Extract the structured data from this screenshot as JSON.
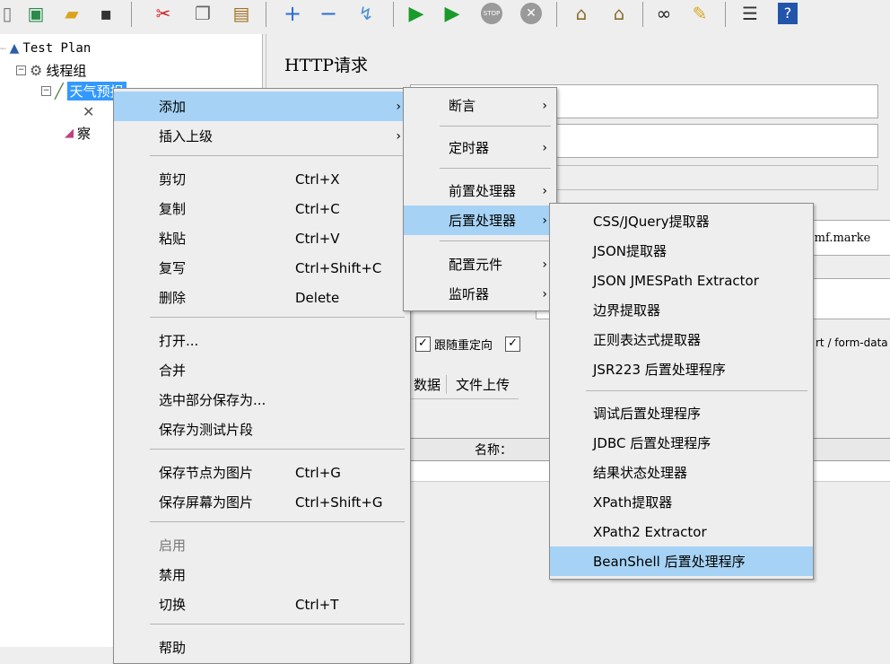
{
  "tree": {
    "root": "Test Plan",
    "thread_group": "线程组",
    "selected_node": "天气预报",
    "child_node_partial": "察"
  },
  "panel": {
    "title": "HTTP请求",
    "field_fragment_1": "vbmf.marke",
    "field_fragment_2": "rt / form-data",
    "follow_redirects_label": "跟随重定向",
    "tab_data_partial": "数据",
    "tab_file_upload": "文件上传",
    "name_column": "名称："
  },
  "context_menu": {
    "items": [
      {
        "label": "添加",
        "shortcut": "",
        "submenu": true
      },
      {
        "label": "插入上级",
        "shortcut": "",
        "submenu": true
      },
      {
        "label": "剪切",
        "shortcut": "Ctrl+X"
      },
      {
        "label": "复制",
        "shortcut": "Ctrl+C"
      },
      {
        "label": "粘贴",
        "shortcut": "Ctrl+V"
      },
      {
        "label": "复写",
        "shortcut": "Ctrl+Shift+C"
      },
      {
        "label": "删除",
        "shortcut": "Delete"
      },
      {
        "label": "打开...",
        "shortcut": ""
      },
      {
        "label": "合并",
        "shortcut": ""
      },
      {
        "label": "选中部分保存为...",
        "shortcut": ""
      },
      {
        "label": "保存为测试片段",
        "shortcut": ""
      },
      {
        "label": "保存节点为图片",
        "shortcut": "Ctrl+G"
      },
      {
        "label": "保存屏幕为图片",
        "shortcut": "Ctrl+Shift+G"
      },
      {
        "label": "启用",
        "shortcut": ""
      },
      {
        "label": "禁用",
        "shortcut": ""
      },
      {
        "label": "切换",
        "shortcut": "Ctrl+T"
      },
      {
        "label": "帮助",
        "shortcut": ""
      }
    ]
  },
  "add_submenu": {
    "items": [
      {
        "label": "断言"
      },
      {
        "label": "定时器"
      },
      {
        "label": "前置处理器"
      },
      {
        "label": "后置处理器"
      },
      {
        "label": "配置元件"
      },
      {
        "label": "监听器"
      }
    ]
  },
  "post_processor_submenu": {
    "items": [
      {
        "label": "CSS/JQuery提取器"
      },
      {
        "label": "JSON提取器"
      },
      {
        "label": "JSON JMESPath Extractor"
      },
      {
        "label": "边界提取器"
      },
      {
        "label": "正则表达式提取器"
      },
      {
        "label": "JSR223 后置处理程序"
      },
      {
        "label": "调试后置处理程序"
      },
      {
        "label": "JDBC 后置处理程序"
      },
      {
        "label": "结果状态处理器"
      },
      {
        "label": "XPath提取器"
      },
      {
        "label": "XPath2 Extractor"
      },
      {
        "label": "BeanShell 后置处理程序"
      }
    ]
  },
  "colors": {
    "highlight": "#a6d3f5",
    "selection": "#3399ff",
    "menu_bg": "#eeeeee"
  }
}
